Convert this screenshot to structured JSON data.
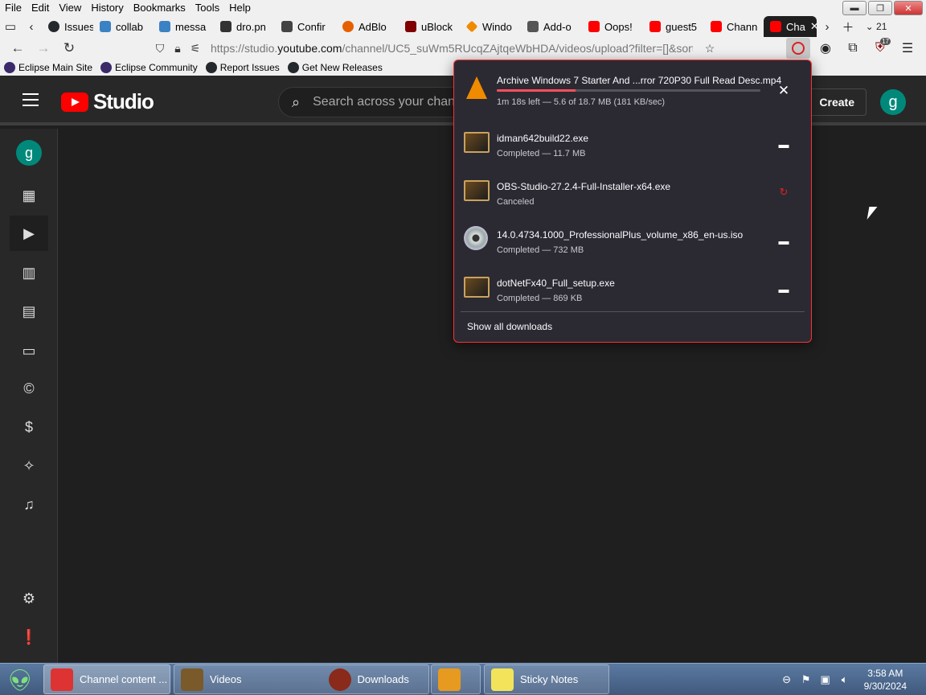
{
  "menubar": {
    "items": [
      "File",
      "Edit",
      "View",
      "History",
      "Bookmarks",
      "Tools",
      "Help"
    ]
  },
  "tabs": [
    {
      "label": "Issues",
      "color": "#24292e"
    },
    {
      "label": "collab",
      "color": "#3b82c4"
    },
    {
      "label": "messa",
      "color": "#3b82c4"
    },
    {
      "label": "dro.pn",
      "color": "#333333"
    },
    {
      "label": "Confir",
      "color": "#444444"
    },
    {
      "label": "AdBlo",
      "color": "#e66000"
    },
    {
      "label": "uBlock",
      "color": "#800000"
    },
    {
      "label": "Windo",
      "color": "#f08a00"
    },
    {
      "label": "Add-o",
      "color": "#555555"
    },
    {
      "label": "Oops!",
      "color": "#ff0000"
    },
    {
      "label": "guest5",
      "color": "#ff0000"
    },
    {
      "label": "Chann",
      "color": "#ff0000"
    },
    {
      "label": "Cha",
      "color": "#ff0000"
    }
  ],
  "tab_overflow_count": "21",
  "navbar": {
    "url_prefix": "https://studio.",
    "url_domain": "youtube.com",
    "url_rest": "/channel/UC5_suWm5RUcqZAjtqeWbHDA/videos/upload?filter=[]&sort",
    "extension_badge": "17"
  },
  "bookmarks": [
    "Eclipse Main Site",
    "Eclipse Community",
    "Report Issues",
    "Get New Releases"
  ],
  "studio": {
    "logo_text": "Studio",
    "search_placeholder": "Search across your channel",
    "create_label": "Create",
    "avatar_letter": "g"
  },
  "rail": {
    "avatar_letter": "g",
    "items": [
      "dashboard-icon",
      "content-icon",
      "analytics-icon",
      "comments-icon",
      "subtitles-icon",
      "copyright-icon",
      "earn-icon",
      "customization-icon",
      "audio-library-icon",
      "settings-icon",
      "feedback-icon"
    ]
  },
  "downloads": {
    "items": [
      {
        "name": "Archive Windows 7 Starter And ...rror 720P30 Full Read Desc.mp4",
        "status": "1m 18s left — 5.6 of 18.7 MB (181 KB/sec)",
        "progress": 0.3,
        "icon": "vlc-icon",
        "action": "close-icon"
      },
      {
        "name": "idman642build22.exe",
        "status": "Completed — 11.7 MB",
        "icon": "exe-icon",
        "action": "folder-icon"
      },
      {
        "name": "OBS-Studio-27.2.4-Full-Installer-x64.exe",
        "status": "Canceled",
        "icon": "exe-icon",
        "action": "retry-icon"
      },
      {
        "name": "14.0.4734.1000_ProfessionalPlus_volume_x86_en-us.iso",
        "status": "Completed — 732 MB",
        "icon": "disc-icon",
        "action": "folder-icon"
      },
      {
        "name": "dotNetFx40_Full_setup.exe",
        "status": "Completed — 869 KB",
        "icon": "exe-icon",
        "action": "folder-icon"
      }
    ],
    "show_all_label": "Show all downloads"
  },
  "taskbar": {
    "items": [
      {
        "label": "Channel content ...",
        "color": "#d33"
      },
      {
        "label": "Videos",
        "color": "#7a5a2a"
      },
      {
        "label": "Downloads",
        "color": "#8a2a1a"
      },
      {
        "label": "",
        "color": "#e69a20"
      },
      {
        "label": "Sticky Notes",
        "color": "#f2e35a"
      }
    ],
    "time": "3:58 AM",
    "date": "9/30/2024"
  }
}
